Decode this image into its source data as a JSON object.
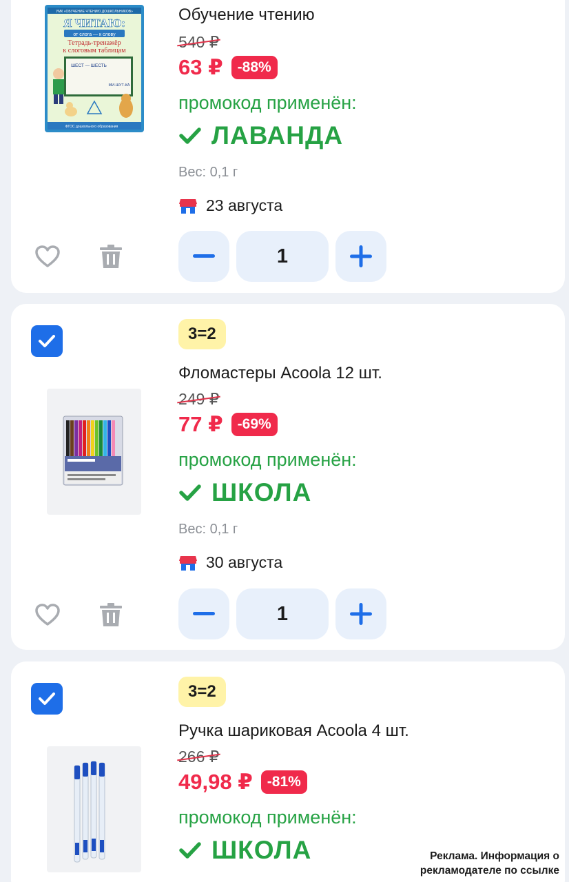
{
  "colors": {
    "accent_blue": "#1e6ee8",
    "price_red": "#f02a4b",
    "promo_green": "#26a244",
    "badge_yellow": "#fff3a8",
    "stepper_bg": "#e8f0fb"
  },
  "cart_items": [
    {
      "title": "Обучение чтению",
      "old_price": "540 ₽",
      "new_price": "63 ₽",
      "discount": "-88%",
      "promo_label": "промокод применён:",
      "promo_code": "ЛАВАНДА",
      "weight": "Вес: 0,1 г",
      "delivery_date": "23 августа",
      "quantity": "1",
      "thumbnail": {
        "header": "УМК «ОБУЧЕНИЕ ЧТЕНИЮ ДОШКОЛЬНИКОВ»",
        "title": "Я ЧИТАЮ:",
        "subtitle": "от слога — к слову",
        "line1": "Тетрадь-тренажёр",
        "line2": "к слоговым таблицам",
        "board_word1": "ШЕСТ — ШЕСТЬ",
        "board_word2": "МИ-ШУТ-КА",
        "footer": "ФГОС дошкольного образования"
      }
    },
    {
      "selected": true,
      "badge": "3=2",
      "title": "Фломастеры Acoola 12 шт.",
      "old_price": "249 ₽",
      "new_price": "77 ₽",
      "discount": "-69%",
      "promo_label": "промокод применён:",
      "promo_code": "ШКОЛА",
      "weight": "Вес: 0,1 г",
      "delivery_date": "30 августа",
      "quantity": "1"
    },
    {
      "selected": true,
      "badge": "3=2",
      "title": "Ручка шариковая Acoola 4 шт.",
      "old_price": "266 ₽",
      "new_price": "49,98 ₽",
      "discount": "-81%",
      "promo_label": "промокод применён:",
      "promo_code": "ШКОЛА"
    }
  ],
  "icons": {
    "favorite": "heart-outline-icon",
    "delete": "trash-icon",
    "decrease": "minus-icon",
    "increase": "plus-icon",
    "store": "store-icon",
    "promo_check": "check-icon",
    "selected": "checkbox-checked-icon"
  },
  "ad_note": {
    "line1": "Реклама. Информация о",
    "line2": "рекламодателе по ссылке"
  }
}
